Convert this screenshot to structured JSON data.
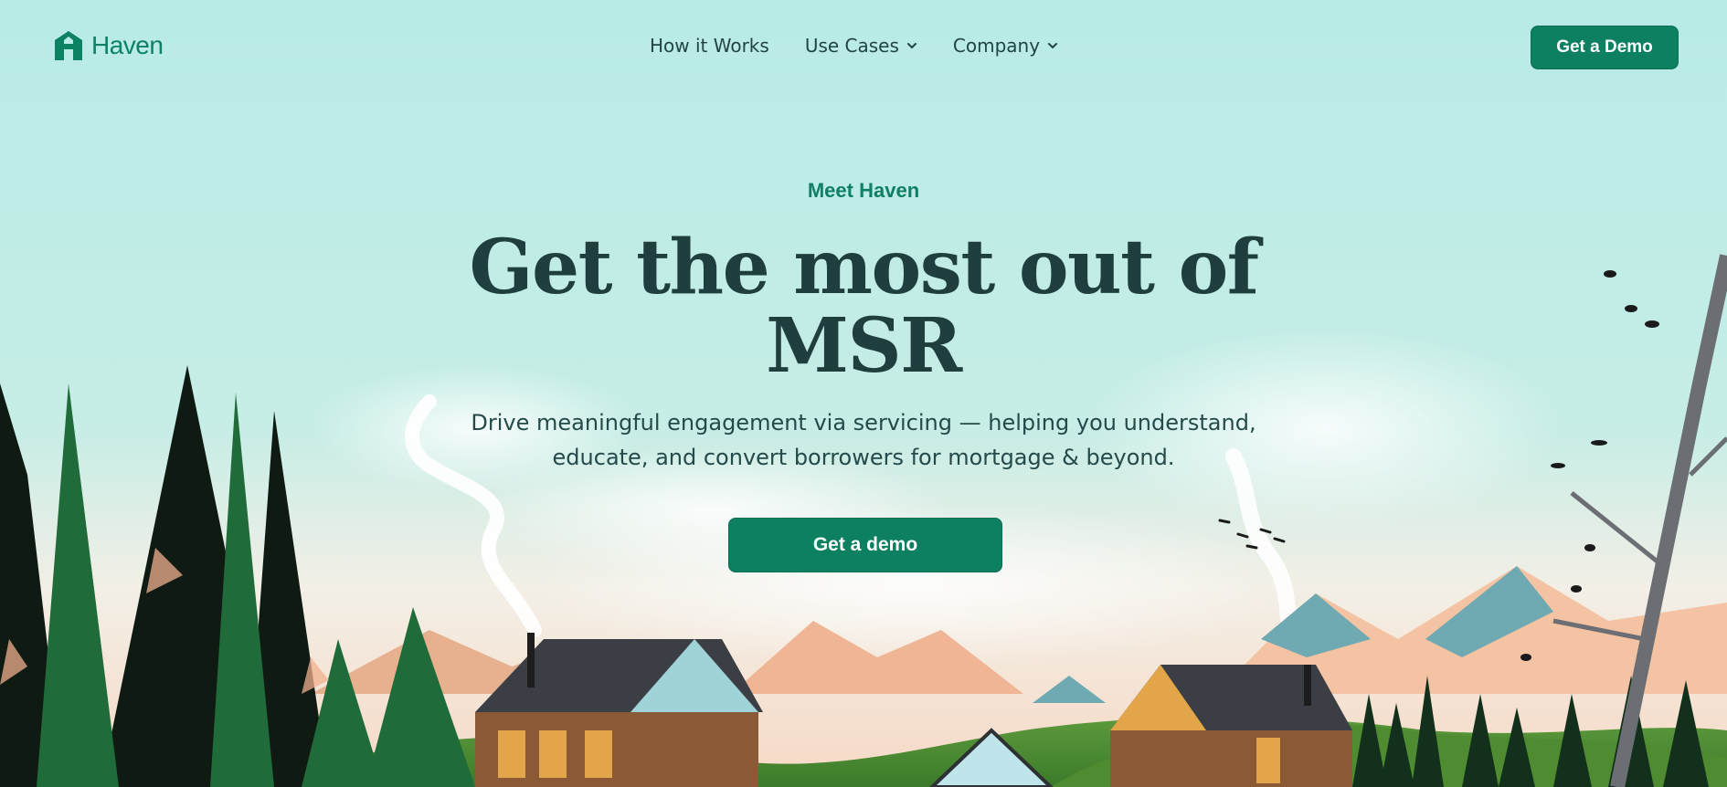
{
  "brand": {
    "name": "Haven",
    "logo_icon": "haven-house-logo-icon",
    "color": "#0c8263"
  },
  "nav": {
    "items": [
      {
        "label": "How it Works",
        "has_dropdown": false
      },
      {
        "label": "Use Cases",
        "has_dropdown": true,
        "icon": "chevron-down-icon"
      },
      {
        "label": "Company",
        "has_dropdown": true,
        "icon": "chevron-down-icon"
      }
    ],
    "cta_label": "Get a Demo"
  },
  "hero": {
    "eyebrow": "Meet Haven",
    "headline_line1": "Get the most out of",
    "headline_line2": "MSR",
    "subtext_line1": "Drive meaningful engagement via servicing — helping you understand,",
    "subtext_line2": "educate, and convert borrowers for mortgage & beyond.",
    "cta_label": "Get a demo"
  },
  "theme": {
    "background": "#b8ebe6",
    "accent": "#0c8061",
    "text_dark": "#1f3f3e"
  }
}
